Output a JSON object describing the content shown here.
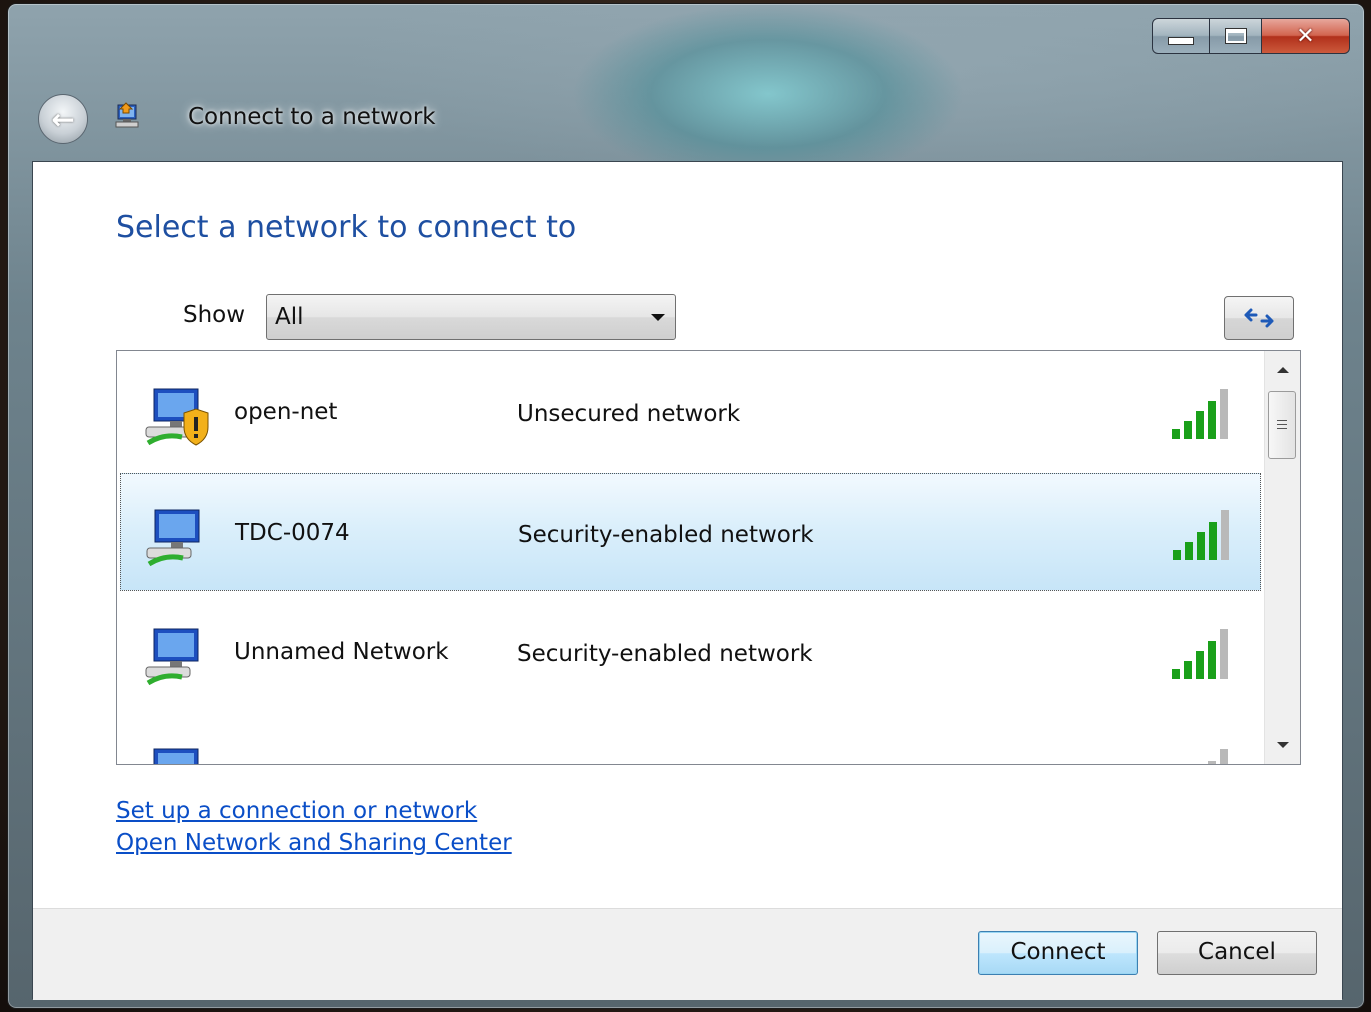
{
  "window": {
    "title": "Connect to a network",
    "caption_buttons": [
      "minimize",
      "maximize",
      "close"
    ]
  },
  "heading": "Select a network to connect to",
  "show": {
    "label": "Show",
    "selected": "All"
  },
  "networks": [
    {
      "name": "open-net",
      "status": "Unsecured network",
      "icon": "unsecured-network-icon",
      "signal_bars": 5,
      "selected": false
    },
    {
      "name": "TDC-0074",
      "status": "Security-enabled network",
      "icon": "network-icon",
      "signal_bars": 5,
      "selected": true
    },
    {
      "name": "Unnamed Network",
      "status": "Security-enabled network",
      "icon": "network-icon",
      "signal_bars": 5,
      "selected": false
    }
  ],
  "links": {
    "setup": "Set up a connection or network",
    "sharing_center": "Open Network and Sharing Center"
  },
  "buttons": {
    "connect": "Connect",
    "cancel": "Cancel"
  },
  "colors": {
    "heading": "#1e4fa1",
    "link": "#0a4ec7",
    "signal": "#1aa01a",
    "selection": "#c7e5f8"
  }
}
